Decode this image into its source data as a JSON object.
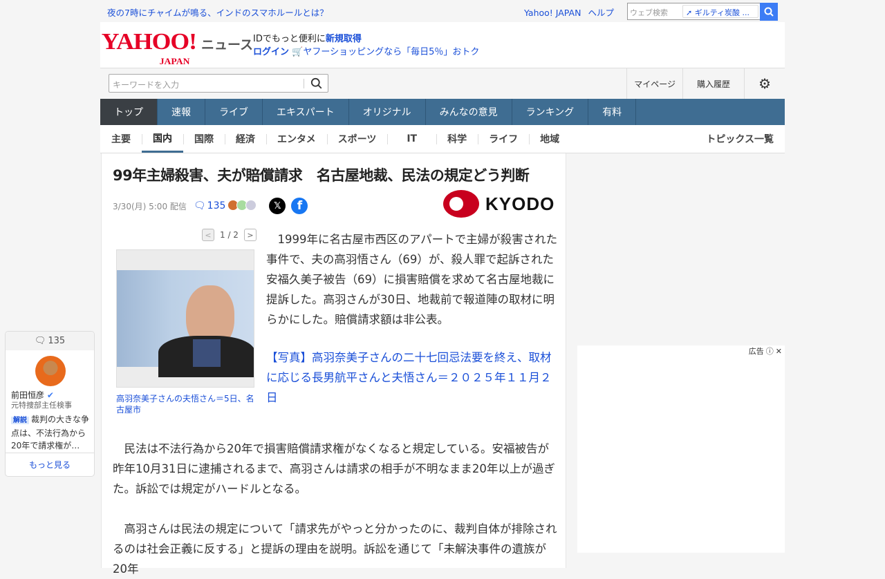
{
  "topbar": {
    "ticker": "夜の7時にチャイムが鳴る、インドのスマホルールとは？",
    "yahoo_link": "Yahoo! JAPAN",
    "help_link": "ヘルプ",
    "web_search_placeholder": "ウェブ検索",
    "web_search_suggestion": "ギルティ炭酸 ..."
  },
  "header": {
    "logo": "YAHOO!",
    "logo_sub": "JAPAN",
    "service": "ニュース",
    "id_text": "IDでもっと便利に",
    "signup": "新規取得",
    "login": "ログイン",
    "shopping_promo": "ヤフーショッピングなら「毎日5％」おトク"
  },
  "search": {
    "placeholder": "キーワードを入力",
    "mypage": "マイページ",
    "history": "購入履歴"
  },
  "nav": [
    "トップ",
    "速報",
    "ライブ",
    "エキスパート",
    "オリジナル",
    "みんなの意見",
    "ランキング",
    "有料"
  ],
  "subnav": [
    "主要",
    "国内",
    "国際",
    "経済",
    "エンタメ",
    "スポーツ",
    "IT",
    "科学",
    "ライフ",
    "地域"
  ],
  "subnav_topics": "トピックス一覧",
  "article": {
    "title": "99年主婦殺害、夫が賠償請求　名古屋地裁、民法の規定どう判断",
    "date": "3/30(月) 5:00 配信",
    "comments": "135",
    "source": "KYODO",
    "pager": "1 / 2",
    "caption": "高羽奈美子さんの夫悟さん＝5日、名古屋市",
    "p1": "1999年に名古屋市西区のアパートで主婦が殺害された事件で、夫の高羽悟さん（69）が、殺人罪で起訴された安福久美子被告（69）に損害賠償を求めて名古屋地裁に提訴した。高羽さんが30日、地裁前で報道陣の取材に明らかにした。賠償請求額は非公表。",
    "photo_link": "【写真】高羽奈美子さんの二十七回忌法要を終え、取材に応じる長男航平さんと夫悟さん＝２０２５年１１月２日",
    "p2": "民法は不法行為から20年で損害賠償請求権がなくなると規定している。安福被告が昨年10月31日に逮捕されるまで、高羽さんは請求の相手が不明なまま20年以上が過ぎた。訴訟では規定がハードルとなる。",
    "p3": "高羽さんは民法の規定について「請求先がやっと分かったのに、裁判自体が排除されるのは社会正義に反する」と提訴の理由を説明。訴訟を通じて「未解決事件の遺族が20年"
  },
  "comment_card": {
    "count": "135",
    "name": "前田恒彦",
    "role": "元特捜部主任検事",
    "tag": "解説",
    "text": "裁判の大きな争点は、不法行為から20年で請求権が…",
    "more": "もっと見る"
  },
  "ad": {
    "label": "広告"
  },
  "colors": {
    "nav": "#3f6d92",
    "link": "#1a4fd8",
    "yahoo_red": "#e60026"
  }
}
